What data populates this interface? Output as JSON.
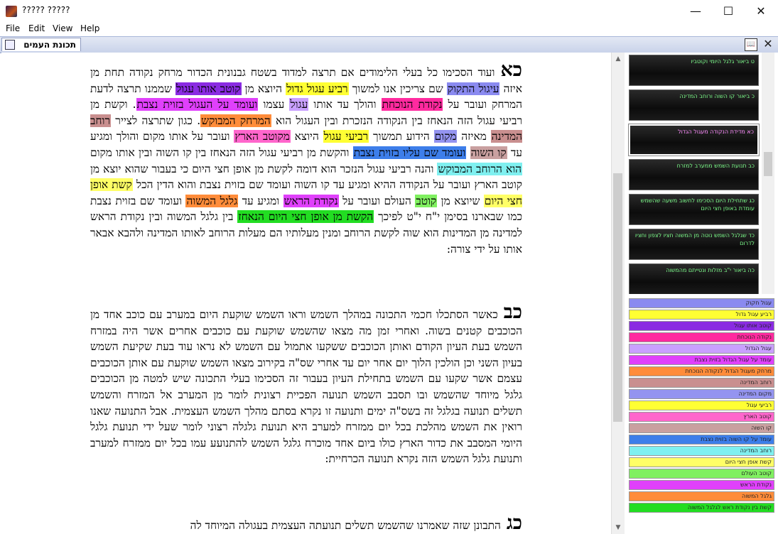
{
  "window": {
    "title": "????? ?????",
    "minimize": "—",
    "maximize": "☐",
    "close": "✕"
  },
  "menu": [
    "File",
    "Edit",
    "View",
    "Help"
  ],
  "toolbar": {
    "tab_label": "תכונת העמים",
    "book_icon": "📖",
    "close_label": "✕"
  },
  "sections": [
    {
      "number": "כא",
      "segments": [
        {
          "t": "ועוד הסכימו כל בעלי הלימודים אם תרצה למדוד בשטח גבנונית הכדור מרחק נקודה תחת מן איזה "
        },
        {
          "t": "עיגול התקוק",
          "c": "#8a8af0"
        },
        {
          "t": " שם צריכין אנו למשוך "
        },
        {
          "t": "רביע עגול גדול",
          "c": "#ffff33"
        },
        {
          "t": " היוצא מן "
        },
        {
          "t": "קוטב אותו עגול",
          "c": "#8a2be2"
        },
        {
          "t": " שממנו תרצה לדעת המרחק ועובר על "
        },
        {
          "t": "נקודת הנוכחת",
          "c": "#ff2a9f"
        },
        {
          "t": " והולך עד אותו "
        },
        {
          "t": "עגול",
          "c": "#c9a0ff"
        },
        {
          "t": " עצמו "
        },
        {
          "t": "ועומד על העגול בזוית נצבת",
          "c": "#e040fb"
        },
        {
          "t": ". וקשת מן רביעי עגול הזה הנאחז בין הנקודה הנזכרת ובין העגול הוא "
        },
        {
          "t": "המרחק המבוקש",
          "c": "#ff8c3a"
        },
        {
          "t": ". כגון שתרצה לצייר "
        },
        {
          "t": "רוחב המדינה",
          "c": "#c98f8f"
        },
        {
          "t": " מאיזה "
        },
        {
          "t": "מקום",
          "c": "#9494f0"
        },
        {
          "t": " הידוע תמשוך "
        },
        {
          "t": "רביעי עגול",
          "c": "#ffff33"
        },
        {
          "t": " היוצא "
        },
        {
          "t": "מקוטב הארץ",
          "c": "#ff66cc"
        },
        {
          "t": " ועובר על אותו מקום והולך ומגיע עד "
        },
        {
          "t": "קו השוה",
          "c": "#c9a0a0"
        },
        {
          "t": " "
        },
        {
          "t": "ועומד שם עליו בזוית נצבת",
          "c": "#3d7eea"
        },
        {
          "t": " והקשת מן רביעי עגול הזה הנאחז בין קו השוה ובין אותו מקום "
        },
        {
          "t": "הוא הרוחב המבוקש",
          "c": "#7ff0f0"
        },
        {
          "t": " והנה רביעי עגול הנזכר הוא דומה לקשת מן אופן חצי היום כי בעבור שהוא יוצא מן קוטב הארץ ועובר על הנקודה ההיא ומגיע עד קו השוה ועומד שם בזוית נצבת והוא הדין הכל "
        },
        {
          "t": "קשת אופן חצי היום",
          "c": "#ffff66"
        },
        {
          "t": " שיוצא מן "
        },
        {
          "t": "קוטב",
          "c": "#80f060"
        },
        {
          "t": " העולם ועובר על "
        },
        {
          "t": "נקודת הראש",
          "c": "#e040fb"
        },
        {
          "t": " ומגיע עד "
        },
        {
          "t": "גלגל המשוה",
          "c": "#ff8c3a"
        },
        {
          "t": " ועומד שם בזוית נצבת כמו שבארנו בסימן י\"ח י\"ט לפיכך "
        },
        {
          "t": "הקשת מן אופן חצי היום הנאחז",
          "c": "#22dd22"
        },
        {
          "t": " בין גלגל המשוה ובין נקודת הראש למדינה מן המדינות הוא שוה לקשת הרוחב ומנין מעלותיו הם מעלות הרוחב לאותו המדינה ולהבא אבאר אותו על ידי צורה:"
        }
      ]
    },
    {
      "number": "כב",
      "segments": [
        {
          "t": "כאשר הסתכלו חכמי התכונה במהלך השמש וראו השמש שוקעת היום במערב עם כוכב אחד מן הכוכבים קטנים בשוה. ואחרי זמן מה מצאו שהשמש שוקעת עם כוכבים אחרים אשר היה במזרח השמש בעת העיון הקודם ואותן הכוכבים ששקעו אתמול עם השמש לא נראו עוד בעת שקיעת השמש בעיון השני וכן הולכין הלוך יום אחר יום עד אחרי שס\"ה בקירוב מצאו השמש שוקעת עם אותן הכוכבים עצמם אשר שקעו עם השמש בתחילת העיון בעבור זה הסכימו בעלי התכונה שיש למטה מן הכוכבים גלגל מיוחד שהשמש ובו תסבב השמש תנועה הפכיית רצונית לומר מן המערב אל המזרח והשמש תשלים תנועה בגלגל זה בשס\"ה ימים ותנועה זו נקרא בסתם מהלך השמש העצמית. אבל התנועה שאנו רואין את השמש מהלכת בכל יום ממזרח למערב היא תנועת גלגלה רצוני לומר שעל ידי תנועת גלגל היומי המסבב את כדור הארץ כולו ביום אחד מוכרח גלגל השמש להתנועע עמו בכל יום ממזרח למערב ותנועת גלגל השמש הזה נקרא תנועה הכרחיית:"
        }
      ]
    },
    {
      "number": "כג",
      "segments": [
        {
          "t": "התבונן שזה שאמרנו שהשמש תשלים תנועתה העצמית בעגולה המיוחד לה"
        }
      ]
    }
  ],
  "cards": [
    {
      "text": "יט ביאור גלגל המזלות",
      "active": false
    },
    {
      "text": "ט ביאור גלגל היומי וקוטביו",
      "active": false
    },
    {
      "text": "כ ביאור קו השוה ורוחב המדינה",
      "active": false
    },
    {
      "text": "כא מדידת הנקודה מעגול הגדול",
      "active": true
    },
    {
      "text": "כב תנועת השמש ממערב למזרח",
      "active": false
    },
    {
      "text": "כג שתחילת היום הסכימו לחשוב משעה שהשמש עומדת באופן חצי היום",
      "active": false
    },
    {
      "text": "כד שגלגל השמש נוטה מן המשוה חציו לצפון וחציו לדרום",
      "active": false
    },
    {
      "text": "כה ביאור י\"ב מזלות ונטייתם מהמשוה",
      "active": false
    }
  ],
  "legend": [
    {
      "label": "עגול חקוק",
      "color": "#8a8af0"
    },
    {
      "label": "רביע עגול גדול",
      "color": "#ffff33"
    },
    {
      "label": "קוטב אותו עגול",
      "color": "#8a2be2"
    },
    {
      "label": "נקודה הנוכחת",
      "color": "#ff2a9f"
    },
    {
      "label": "עגול הגדול",
      "color": "#c9a0ff"
    },
    {
      "label": "עומד על עגול הגדול בזוית נצבת",
      "color": "#e040fb"
    },
    {
      "label": "מרחק מעגול הגדול לנקודה הנוכחת",
      "color": "#ff8c3a"
    },
    {
      "label": "רוחב המדינה",
      "color": "#c98f8f"
    },
    {
      "label": "מקום המדינה",
      "color": "#9494f0"
    },
    {
      "label": "רביעי עגול",
      "color": "#ffff33"
    },
    {
      "label": "קוטב הארץ",
      "color": "#ff66cc"
    },
    {
      "label": "קו השוה",
      "color": "#c9a0a0"
    },
    {
      "label": "עומד על קו השוה בזוית נצבת",
      "color": "#3d7eea"
    },
    {
      "label": "רוחב המדינה",
      "color": "#7ff0f0"
    },
    {
      "label": "קשת אופן חצי היום",
      "color": "#ffff66"
    },
    {
      "label": "קוטב העולם",
      "color": "#80f060"
    },
    {
      "label": "נקודת הראש",
      "color": "#e040fb"
    },
    {
      "label": "גלגל המשוה",
      "color": "#ff8c3a"
    },
    {
      "label": "קשת בין נקודת ראש לגלגל המשוה",
      "color": "#22dd22"
    }
  ]
}
